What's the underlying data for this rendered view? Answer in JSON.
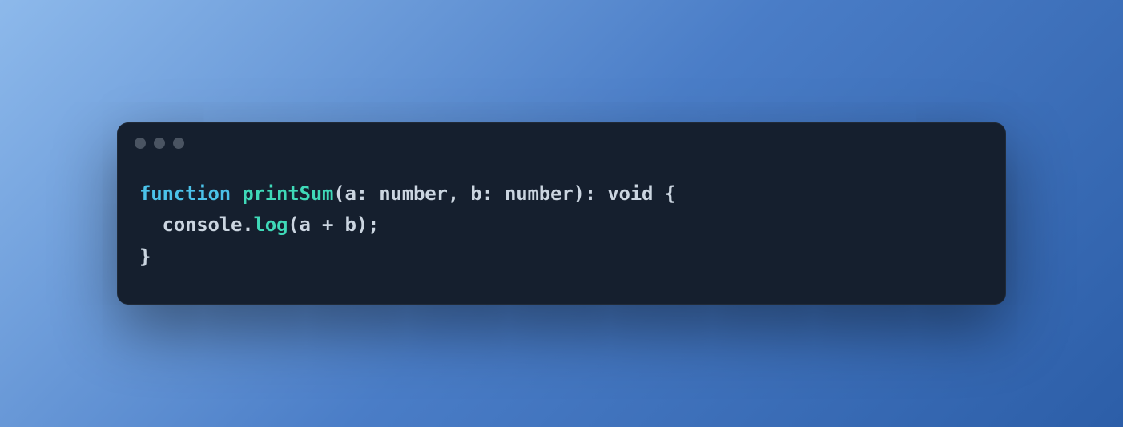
{
  "code": {
    "line1": {
      "keyword": "function",
      "space1": " ",
      "funcName": "printSum",
      "openParen": "(",
      "param1": "a",
      "colon1": ": ",
      "type1": "number",
      "comma": ", ",
      "param2": "b",
      "colon2": ": ",
      "type2": "number",
      "closeParen": ")",
      "colon3": ": ",
      "returnType": "void",
      "space2": " ",
      "openBrace": "{"
    },
    "line2": {
      "indent": "  ",
      "obj": "console",
      "dot": ".",
      "method": "log",
      "openParen": "(",
      "argA": "a",
      "op": " + ",
      "argB": "b",
      "closeParen": ")",
      "semi": ";"
    },
    "line3": {
      "closeBrace": "}"
    }
  }
}
